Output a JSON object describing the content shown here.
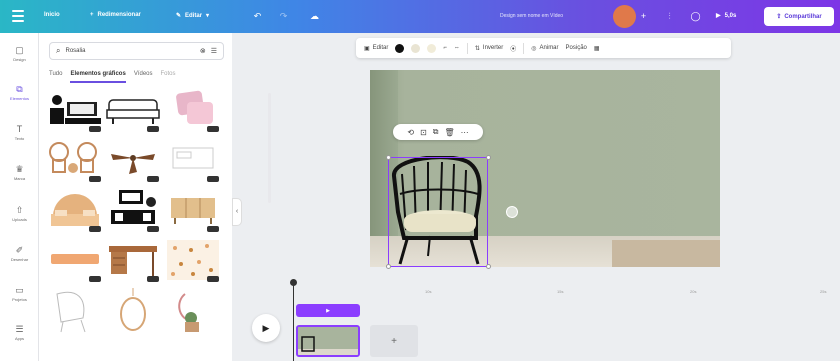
{
  "topbar": {
    "home_label": "Inicio",
    "resize_label": "Redimensionar",
    "edit_label": "Editar",
    "doc_title": "Design sem nome em Vídeo",
    "play_label": "5,0s",
    "share_label": "Compartilhar"
  },
  "rail": {
    "items": [
      {
        "label": "Design",
        "icon": "layout-icon"
      },
      {
        "label": "Elementos",
        "icon": "shapes-icon"
      },
      {
        "label": "Texto",
        "icon": "text-icon"
      },
      {
        "label": "Marca",
        "icon": "brand-icon"
      },
      {
        "label": "Uploads",
        "icon": "upload-icon"
      },
      {
        "label": "Desenhar",
        "icon": "draw-icon"
      },
      {
        "label": "Projetos",
        "icon": "folder-icon"
      },
      {
        "label": "Apps",
        "icon": "apps-icon"
      }
    ]
  },
  "panel": {
    "search_value": "Rosalia",
    "tabs": [
      "Tudo",
      "Elementos gráficos",
      "Vídeos",
      "Fotos"
    ]
  },
  "toolbar": {
    "edit_label": "Editar",
    "invert_label": "Inverter",
    "effects_label": "Animar",
    "position_label": "Posição"
  },
  "colors": {
    "accent": "#8b3dff",
    "topbar_start": "#2ab7c6",
    "topbar_end": "#7d36e6",
    "wall": "#a9b59e",
    "avatar": "#e0794a"
  },
  "timeline": {
    "ruler_ticks": [
      "10s",
      "15s",
      "20s",
      "25s"
    ],
    "audio_clip_label": "▶",
    "add_label": "+"
  }
}
